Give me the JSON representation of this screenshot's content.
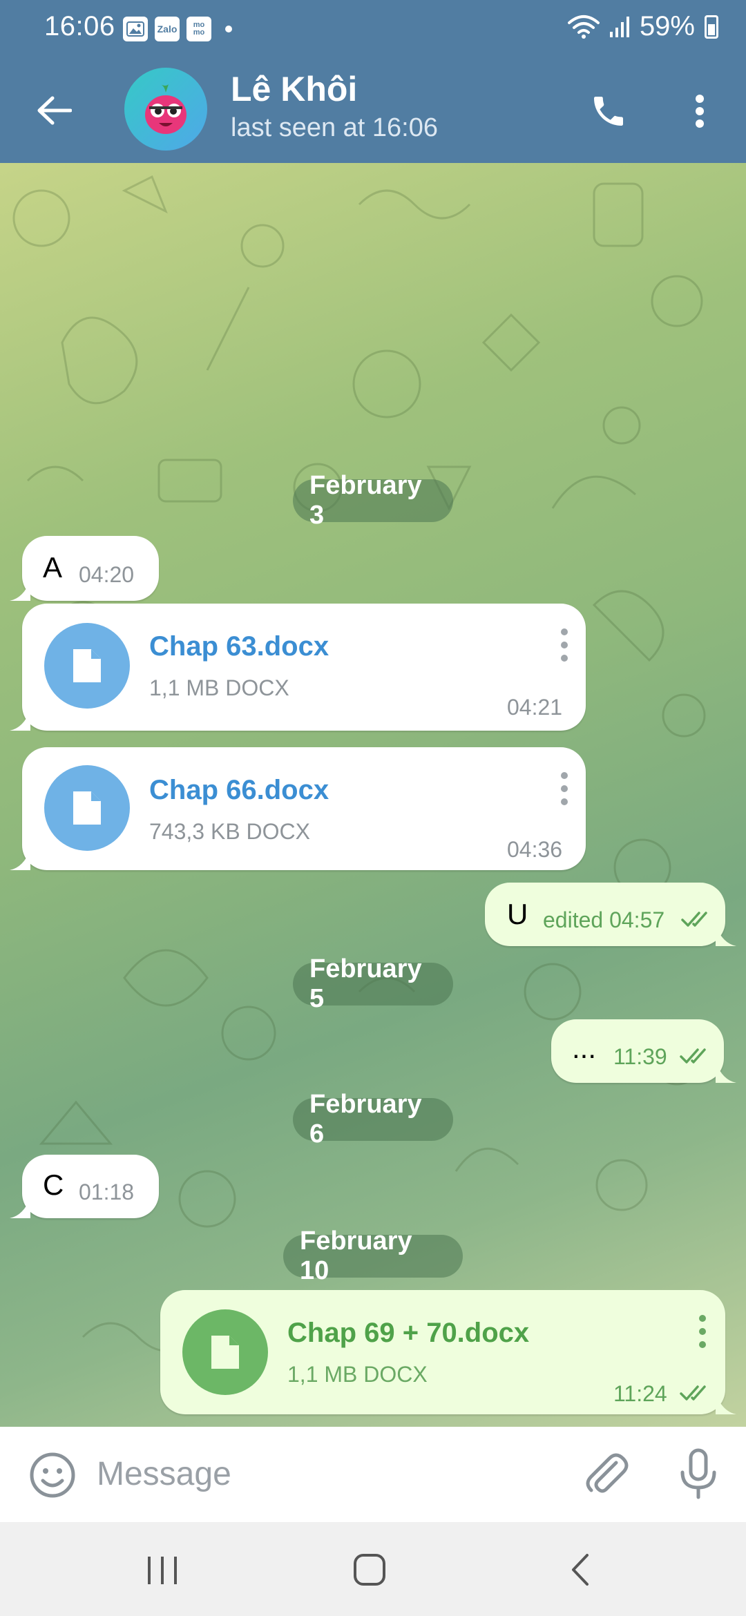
{
  "status_bar": {
    "time": "16:06",
    "notif_zalo": "Zalo",
    "notif_momo": "mo mo",
    "battery": "59%"
  },
  "header": {
    "contact_name": "Lê Khôi",
    "last_seen": "last seen at 16:06"
  },
  "messages": {
    "date_feb3": "February 3",
    "msg_a": {
      "text": "A",
      "time": "04:20"
    },
    "file_63": {
      "name": "Chap 63.docx",
      "size": "1,1 MB DOCX",
      "time": "04:21"
    },
    "file_66": {
      "name": "Chap 66.docx",
      "size": "743,3 KB DOCX",
      "time": "04:36"
    },
    "msg_u": {
      "text": "U",
      "time": "edited 04:57"
    },
    "date_feb5": "February 5",
    "msg_dots": {
      "text": "...",
      "time": "11:39"
    },
    "date_feb6": "February 6",
    "msg_c": {
      "text": "C",
      "time": "01:18"
    },
    "date_feb10": "February 10",
    "file_69": {
      "name": "Chap 69 + 70.docx",
      "size": "1,1 MB DOCX",
      "time": "11:24"
    }
  },
  "input": {
    "placeholder": "Message",
    "value": ""
  },
  "colors": {
    "header": "#517da2",
    "incoming_bubble": "#ffffff",
    "outgoing_bubble": "#effedd",
    "incoming_accent": "#3b8ed3",
    "outgoing_accent": "#4fa249"
  },
  "icons": {
    "back": "arrow-left-icon",
    "call": "phone-icon",
    "menu": "kebab-menu-icon",
    "emoji": "smiley-icon",
    "attach": "paperclip-icon",
    "mic": "microphone-icon",
    "file": "document-icon",
    "read": "double-check-icon"
  }
}
